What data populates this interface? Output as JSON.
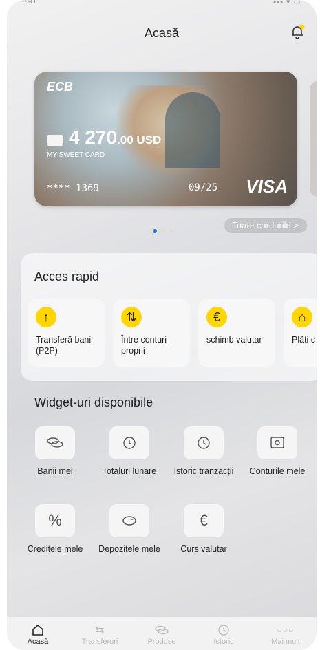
{
  "status": {
    "time": "9:41",
    "right": "▪▪▪ ▾ ▭"
  },
  "header": {
    "title": "Acasă"
  },
  "card": {
    "brand": "ECB",
    "amount_int": "4 270",
    "amount_dec": ".00 USD",
    "name": "MY SWEET CARD",
    "number": "**** 1369",
    "expiry": "09/25",
    "network": "VISA"
  },
  "carousel": {
    "all_cards": "Toate cardurile  >"
  },
  "quick": {
    "title": "Acces rapid",
    "items": [
      {
        "label": "Transferă bani (P2P)",
        "icon": "arrow-up-icon"
      },
      {
        "label": "Între conturi proprii",
        "icon": "swap-arrows-icon"
      },
      {
        "label": "schimb valutar",
        "icon": "euro-icon"
      },
      {
        "label": "Plăți c factur",
        "icon": "home-icon"
      }
    ]
  },
  "widgets": {
    "title": "Widget-uri disponibile",
    "items": [
      {
        "label": "Banii mei",
        "icon": "coins-icon"
      },
      {
        "label": "Totaluri lunare",
        "icon": "history-icon"
      },
      {
        "label": "Istoric tranzacții",
        "icon": "history-icon"
      },
      {
        "label": "Conturile mele",
        "icon": "safe-icon"
      },
      {
        "label": "Creditele mele",
        "icon": "percent-icon"
      },
      {
        "label": "Depozitele mele",
        "icon": "piggy-bank-icon"
      },
      {
        "label": "Curs valutar",
        "icon": "euro-icon"
      }
    ]
  },
  "tabs": [
    {
      "label": "Acasă",
      "icon": "home-icon"
    },
    {
      "label": "Transferuri",
      "icon": "transfer-icon"
    },
    {
      "label": "Produse",
      "icon": "coins-icon"
    },
    {
      "label": "Istoric",
      "icon": "clock-icon"
    },
    {
      "label": "Mai mult",
      "icon": "more-icon"
    }
  ],
  "colors": {
    "accent": "#ffd600",
    "active_dot": "#3a7bd5"
  }
}
